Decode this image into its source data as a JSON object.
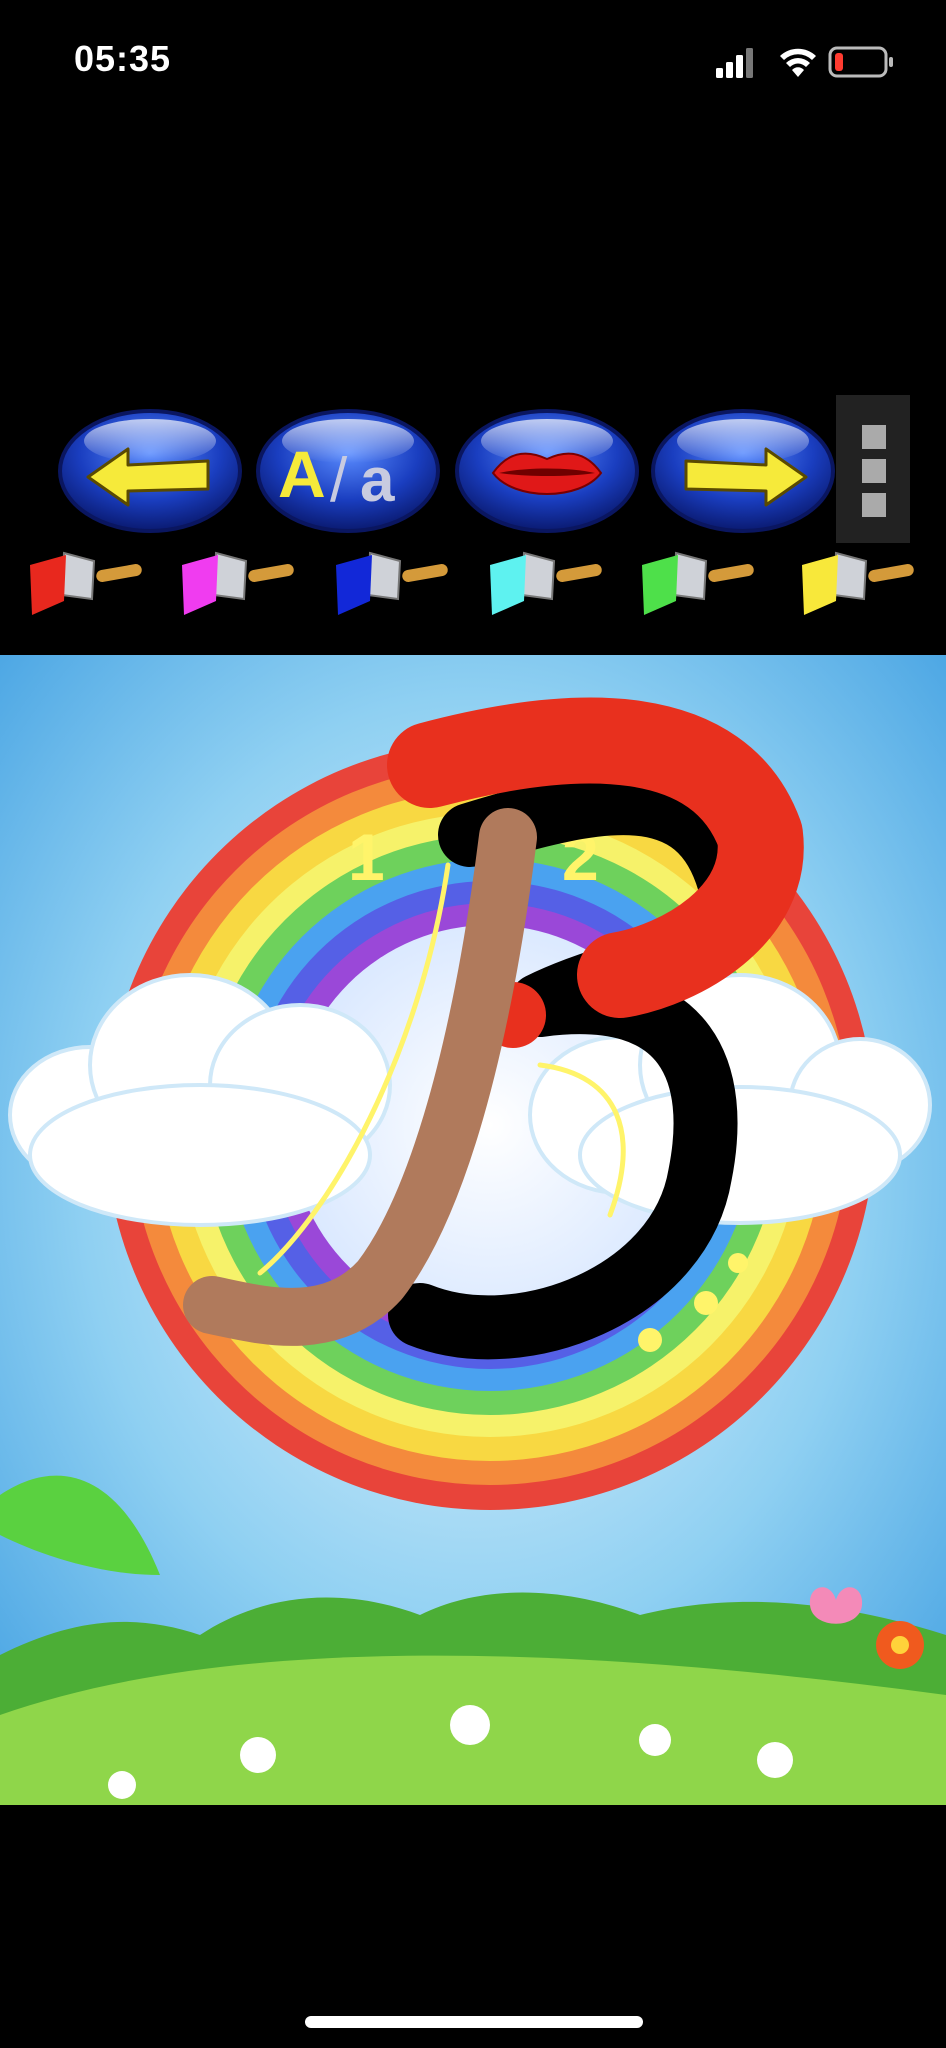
{
  "status_bar": {
    "time": "05:35",
    "icons": [
      "cellular-signal-icon",
      "wifi-icon",
      "battery-low-icon"
    ],
    "battery_color": "#ff3b30"
  },
  "toolbar": {
    "buttons": [
      {
        "name": "back-button",
        "icon": "arrow-left-icon"
      },
      {
        "name": "letter-case-button",
        "label_upper": "A",
        "label_sep": "/",
        "label_lower": "a"
      },
      {
        "name": "sound-button",
        "icon": "lips-icon"
      },
      {
        "name": "next-button",
        "icon": "arrow-right-icon"
      }
    ],
    "menu_icon": "menu-icon"
  },
  "brushes": [
    {
      "name": "red",
      "color": "#e8281e"
    },
    {
      "name": "magenta",
      "color": "#f03cf0"
    },
    {
      "name": "blue",
      "color": "#1228d8"
    },
    {
      "name": "cyan",
      "color": "#5ef2f0"
    },
    {
      "name": "green",
      "color": "#4ee04a"
    },
    {
      "name": "yellow",
      "color": "#f8e83a"
    }
  ],
  "canvas": {
    "stroke_numbers": [
      "1",
      "2"
    ],
    "paint_colors": {
      "brown": "#b07a5c",
      "red": "#e8301e",
      "black": "#000000"
    }
  }
}
